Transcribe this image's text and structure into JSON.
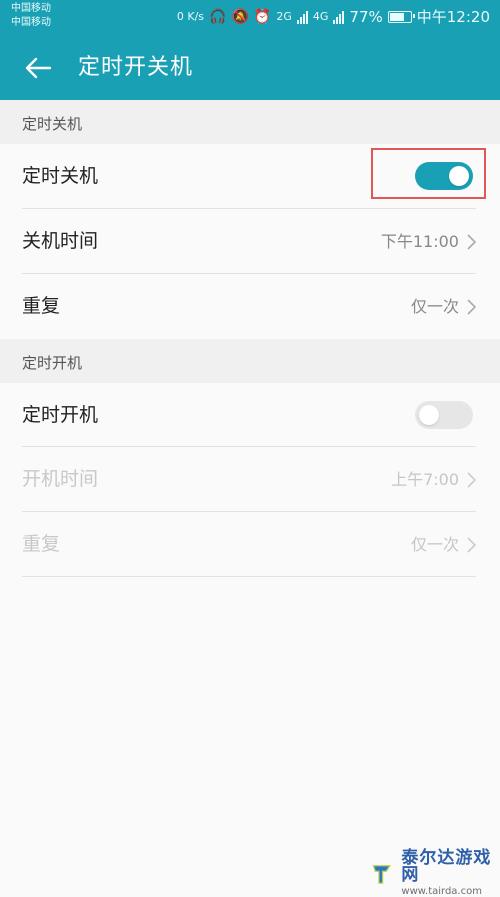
{
  "status_bar": {
    "carrier_1": "中国移动",
    "carrier_2": "中国移动",
    "network_speed": "0 K/s",
    "network_type_1": "2G",
    "network_type_2": "4G",
    "battery_percent": "77%",
    "time": "中午12:20"
  },
  "app_bar": {
    "title": "定时开关机"
  },
  "sections": {
    "shutdown": {
      "header": "定时关机",
      "toggle_label": "定时关机",
      "toggle_on": true,
      "time_label": "关机时间",
      "time_value": "下午11:00",
      "repeat_label": "重复",
      "repeat_value": "仅一次"
    },
    "startup": {
      "header": "定时开机",
      "toggle_label": "定时开机",
      "toggle_on": false,
      "time_label": "开机时间",
      "time_value": "上午7:00",
      "repeat_label": "重复",
      "repeat_value": "仅一次"
    }
  },
  "watermark": {
    "title": "泰尔达游戏网",
    "url": "www.tairda.com"
  },
  "colors": {
    "accent": "#1aa0b4",
    "highlight": "#e35656",
    "background": "#fafafa",
    "section_background": "#f0f0f0"
  }
}
